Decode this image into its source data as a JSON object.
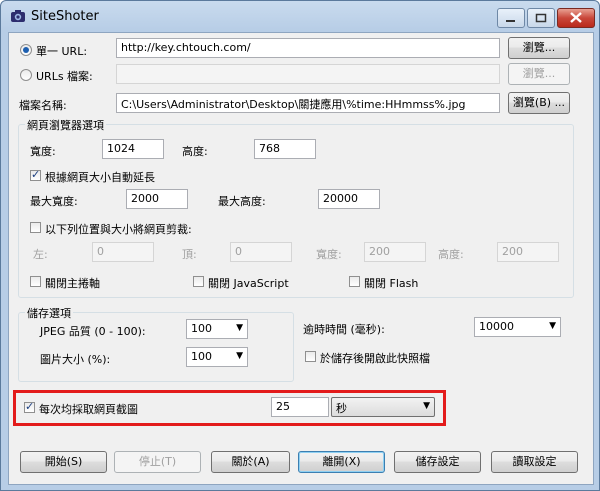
{
  "window": {
    "title": "SiteShoter"
  },
  "source": {
    "single_url_label": "單一 URL:",
    "single_url_value": "http://key.chtouch.com/",
    "urls_file_label": "URLs 檔案:",
    "urls_file_value": "",
    "browse_label": "瀏覽...",
    "browse2_label": "瀏覽..."
  },
  "filename": {
    "label": "檔案名稱:",
    "value": "C:\\Users\\Administrator\\Desktop\\關捷應用\\%time:HHmmss%.jpg",
    "browse_label": "瀏覽(B) ..."
  },
  "browser_options": {
    "title": "網頁瀏覽器選項",
    "width_label": "寬度:",
    "width_value": "1024",
    "height_label": "高度:",
    "height_value": "768",
    "auto_extend_label": "根據網頁大小自動延長",
    "max_width_label": "最大寬度:",
    "max_width_value": "2000",
    "max_height_label": "最大高度:",
    "max_height_value": "20000",
    "crop_label": "以下列位置與大小將網頁剪裁:",
    "left_label": "左:",
    "left_value": "0",
    "top_label": "頂:",
    "top_value": "0",
    "crop_width_label": "寬度:",
    "crop_width_value": "200",
    "crop_height_label": "高度:",
    "crop_height_value": "200",
    "close_scroll_label": "關閉主捲軸",
    "close_js_label": "關閉 JavaScript",
    "close_flash_label": "關閉 Flash"
  },
  "save_options": {
    "title": "儲存選項",
    "jpeg_quality_label": "JPEG 品質 (0 - 100):",
    "jpeg_quality_value": "100",
    "image_size_label": "圖片大小 (%):",
    "image_size_value": "100",
    "timeout_label": "逾時時間 (毫秒):",
    "timeout_value": "10000",
    "open_after_save_label": "於儲存後開啟此快照檔"
  },
  "repeat": {
    "label": "每次均採取網頁截圖",
    "value": "25",
    "unit": "秒"
  },
  "buttons": {
    "start": "開始(S)",
    "stop": "停止(T)",
    "about": "關於(A)",
    "exit": "離開(X)",
    "save_settings": "儲存設定",
    "load_settings": "讀取設定"
  },
  "colors": {
    "highlight": "#e31b1b",
    "titlebar": "#c9dbee"
  }
}
